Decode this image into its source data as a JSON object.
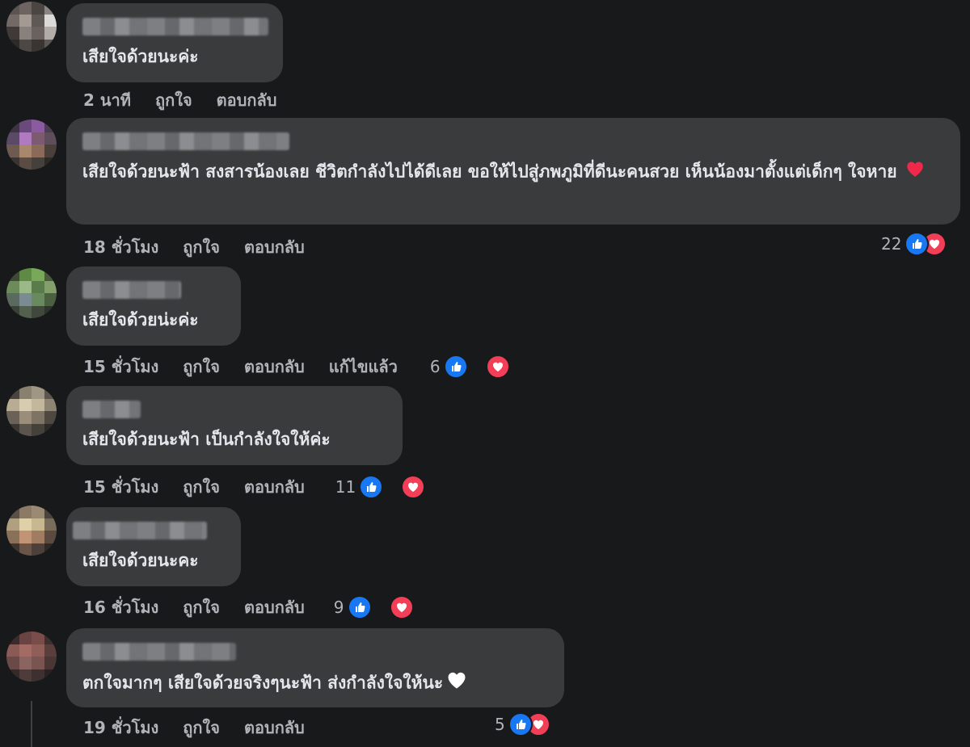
{
  "actions": {
    "like": "ถูกใจ",
    "reply": "ตอบกลับ",
    "edited": "แก้ไขแล้ว"
  },
  "colors": {
    "background": "#18191a",
    "bubble": "#3a3b3c",
    "like": "#1877f2",
    "love": "#f33e58",
    "heart_red": "#f02849",
    "heart_white": "#ffffff"
  },
  "comments": [
    {
      "text": "เสียใจด้วยนะค่ะ",
      "time": "2 นาที"
    },
    {
      "text": "เสียใจด้วยนะฟ้า สงสารน้องเลย ชีวิตกำลังไปได้ดีเลย ขอให้ไปสู่ภพภูมิที่ดีนะคนสวย เห็นน้องมาตั้งแต่เด็กๆ ใจหาย",
      "emoji": "red-heart",
      "time": "18 ชั่วโมง",
      "reactions": "22"
    },
    {
      "text": "เสียใจด้วยน่ะค่ะ",
      "time": "15 ชั่วโมง",
      "reactions": "6"
    },
    {
      "text": "เสียใจด้วยนะฟ้า เป็นกำลังใจให้ค่ะ",
      "time": "15 ชั่วโมง",
      "reactions": "11"
    },
    {
      "text": "เสียใจด้วยนะคะ",
      "time": "16 ชั่วโมง",
      "reactions": "9"
    },
    {
      "text": "ตกใจมากๆ เสียใจด้วยจริงๆนะฟ้า ส่งกำลังใจให้นะ",
      "emoji": "white-heart",
      "time": "19 ชั่วโมง",
      "reactions": "5"
    }
  ]
}
